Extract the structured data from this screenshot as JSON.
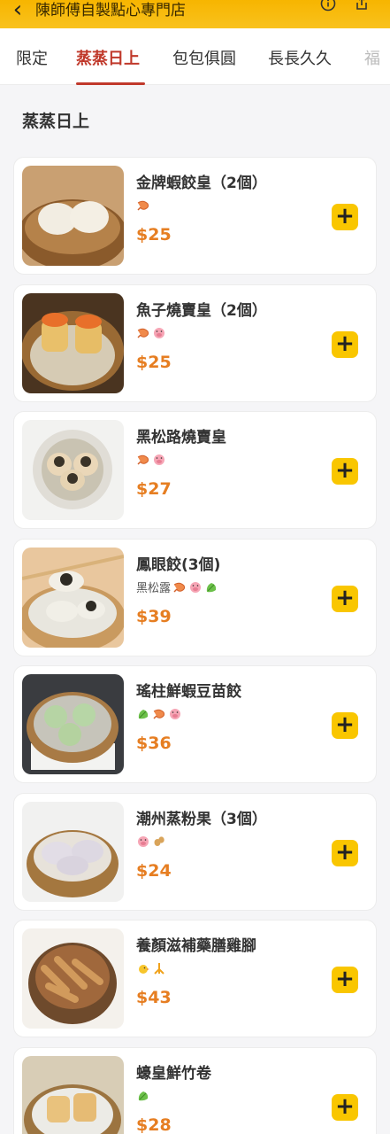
{
  "header": {
    "title": "陳師傅自製點心專門店",
    "back_icon": "chevron-left-icon",
    "info_icon": "info-icon",
    "share_icon": "share-icon",
    "color": "#f7b500"
  },
  "tabs": [
    {
      "label": "限定"
    },
    {
      "label": "蒸蒸日上",
      "active": true
    },
    {
      "label": "包包俱圓"
    },
    {
      "label": "長長久久"
    },
    {
      "label": "福"
    }
  ],
  "section": {
    "title": "蒸蒸日上"
  },
  "items": [
    {
      "name": "金牌蝦餃皇（2個）",
      "note": "",
      "tags": [
        "shrimp-icon"
      ],
      "price": "$25"
    },
    {
      "name": "魚子燒賣皇（2個）",
      "note": "",
      "tags": [
        "shrimp-icon",
        "pig-icon"
      ],
      "price": "$25"
    },
    {
      "name": "黑松路燒賣皇",
      "note": "",
      "tags": [
        "shrimp-icon",
        "pig-icon"
      ],
      "price": "$27"
    },
    {
      "name": "鳳眼餃(3個)",
      "note": "黑松露",
      "tags": [
        "shrimp-icon",
        "pig-icon",
        "vegetable-icon"
      ],
      "price": "$39"
    },
    {
      "name": "瑤柱鮮蝦豆苗餃",
      "note": "",
      "tags": [
        "vegetable-icon",
        "shrimp-icon",
        "pig-icon"
      ],
      "price": "$36"
    },
    {
      "name": "潮州蒸粉果（3個）",
      "note": "",
      "tags": [
        "pig-icon",
        "peanut-icon"
      ],
      "price": "$24"
    },
    {
      "name": "養顏滋補藥膳雞腳",
      "note": "",
      "tags": [
        "chick-icon",
        "chicken-foot-icon"
      ],
      "price": "$43"
    },
    {
      "name": "蠔皇鮮竹卷",
      "note": "",
      "tags": [
        "vegetable-icon"
      ],
      "price": "$28"
    }
  ],
  "colors": {
    "accent": "#c0392b",
    "price": "#e67e22",
    "add_button": "#f9c600"
  }
}
